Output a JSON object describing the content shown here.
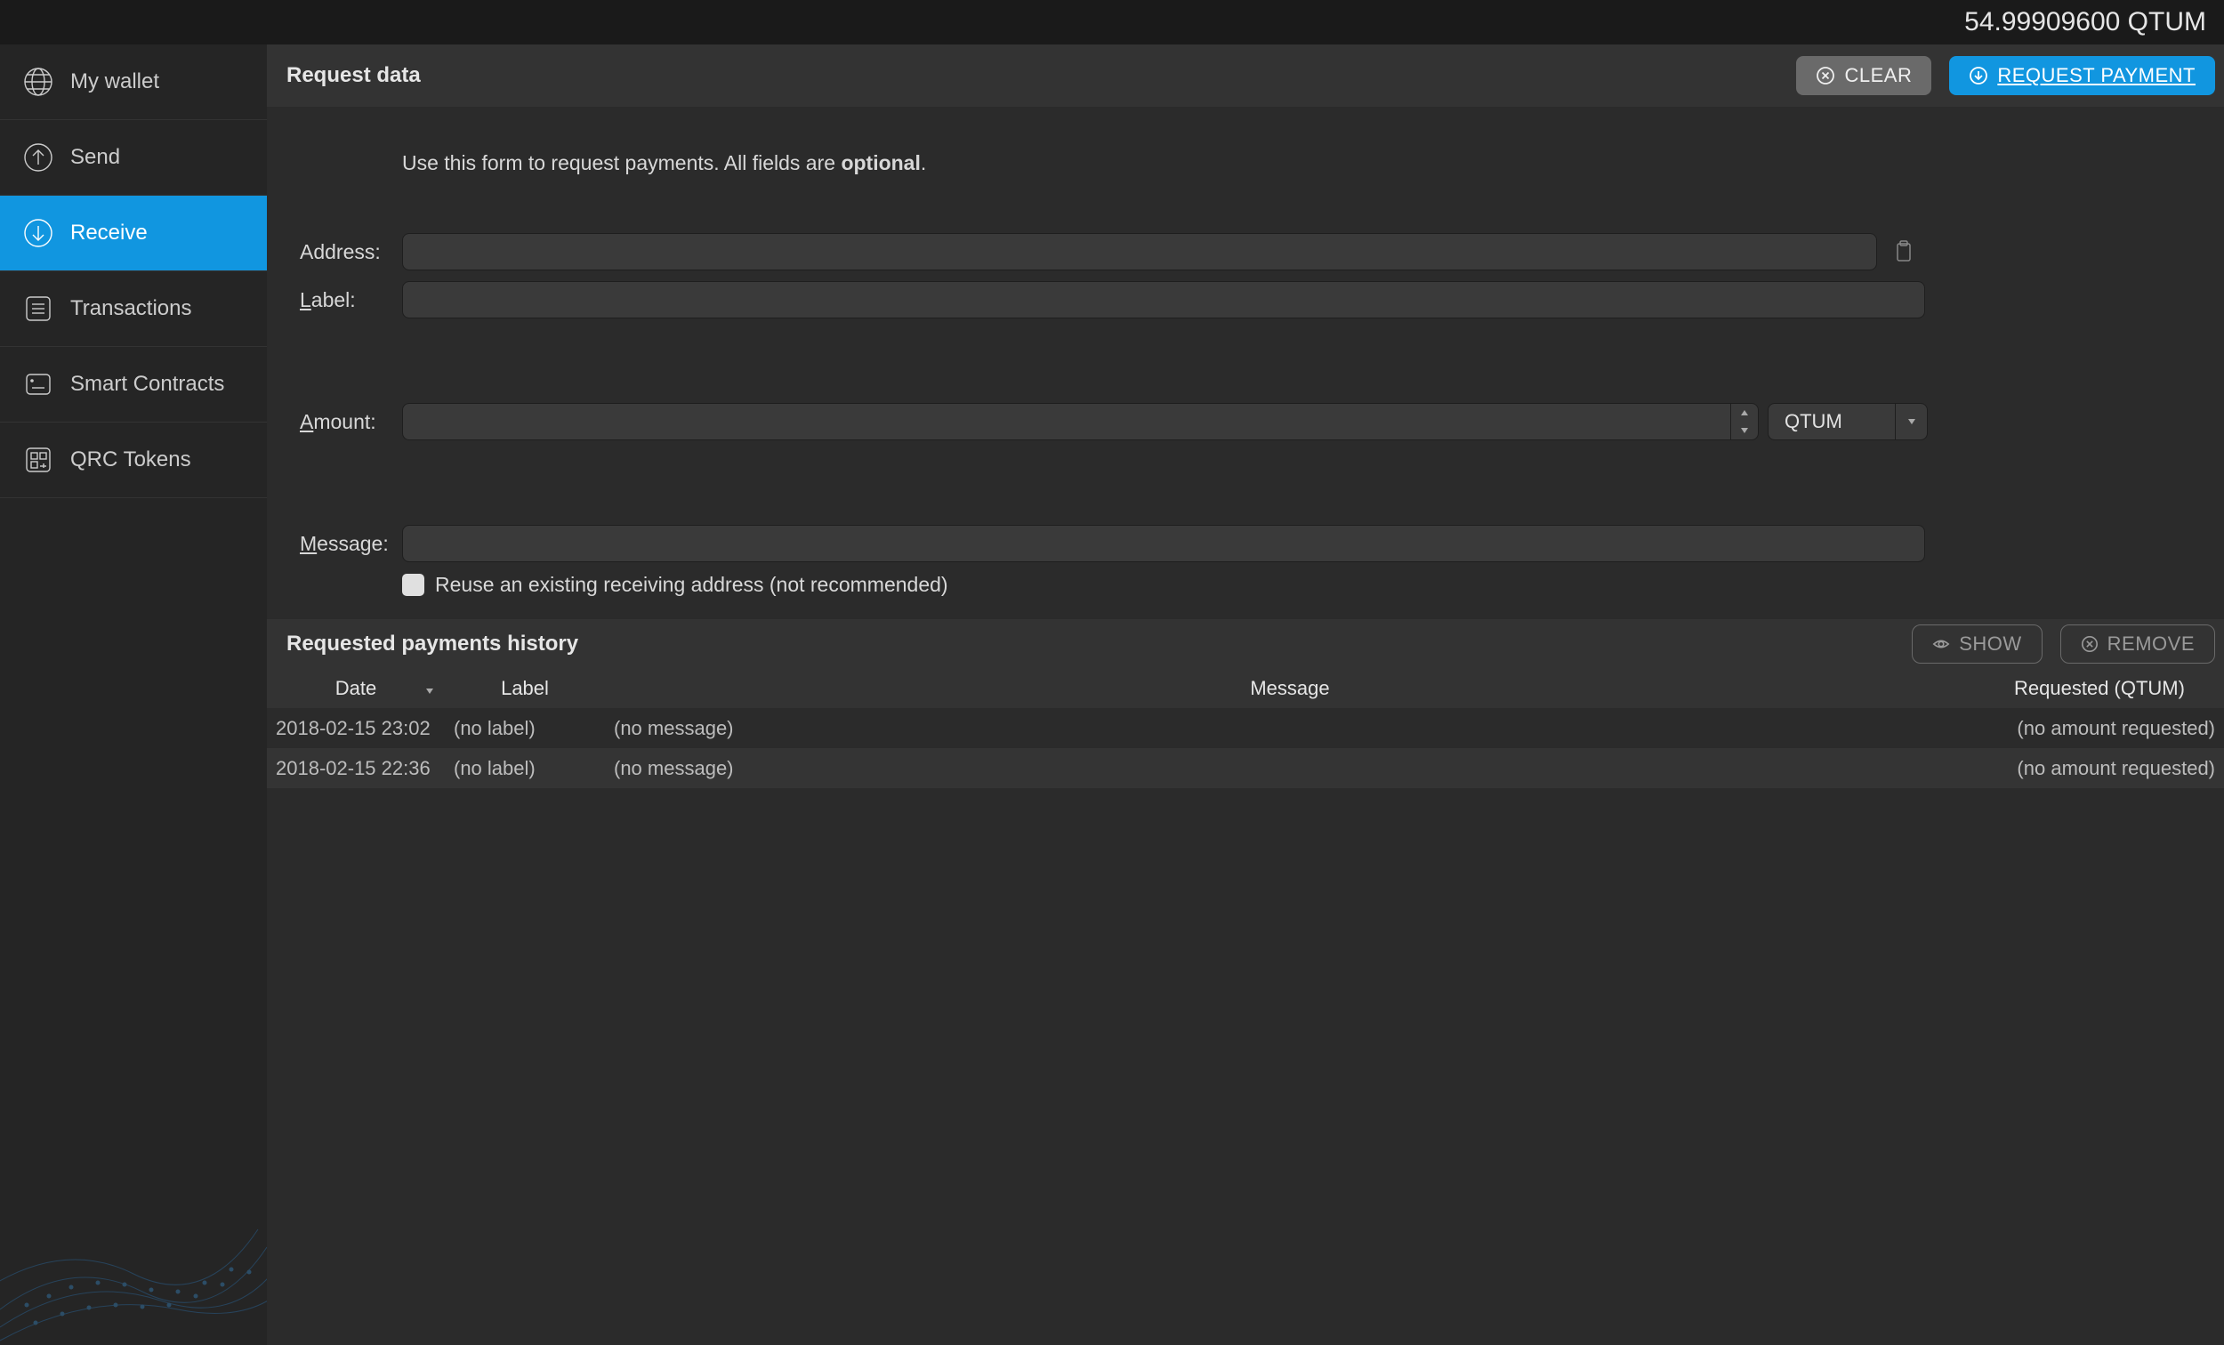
{
  "top_bar": {
    "balance": "54.99909600 QTUM"
  },
  "sidebar": {
    "items": [
      {
        "label": "My wallet",
        "icon": "globe-icon"
      },
      {
        "label": "Send",
        "icon": "send-icon"
      },
      {
        "label": "Receive",
        "icon": "receive-icon"
      },
      {
        "label": "Transactions",
        "icon": "transactions-icon"
      },
      {
        "label": "Smart Contracts",
        "icon": "smart-contracts-icon"
      },
      {
        "label": "QRC Tokens",
        "icon": "qrc-tokens-icon"
      }
    ],
    "active_index": 2
  },
  "panel": {
    "title": "Request data",
    "clear_label": "CLEAR",
    "request_payment_label": "REQUEST PAYMENT",
    "instruction_prefix": "Use this form to request payments. All fields are ",
    "instruction_strong": "optional",
    "instruction_suffix": ".",
    "labels": {
      "address": "Address:",
      "label": "abel:",
      "label_u": "L",
      "amount": "mount:",
      "amount_u": "A",
      "message": "essage:",
      "message_u": "M"
    },
    "currency_selected": "QTUM",
    "reuse_checkbox_label": "Reuse an existing receiving address (not recommended)",
    "inputs": {
      "address_value": "",
      "label_value": "",
      "amount_value": "",
      "message_value": ""
    }
  },
  "history": {
    "title": "Requested payments history",
    "show_label": "SHOW",
    "remove_label": "REMOVE",
    "columns": {
      "date": "Date",
      "label": "Label",
      "message": "Message",
      "requested": "Requested (QTUM)"
    },
    "rows": [
      {
        "date": "2018-02-15 23:02",
        "label": "(no label)",
        "message": "(no message)",
        "requested": "(no amount requested)"
      },
      {
        "date": "2018-02-15 22:36",
        "label": "(no label)",
        "message": "(no message)",
        "requested": "(no amount requested)"
      }
    ]
  }
}
